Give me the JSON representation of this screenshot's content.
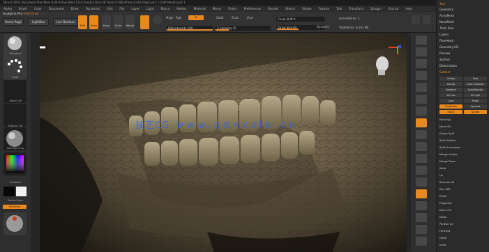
{
  "titlebar": {
    "text": "Zbrush 2021 Document   Free Mem 6.09   Active Mem 1213   Scratch Disk 48   Timer 0.008   ATime 0.001   PolyCount 1.2 KP   MeshCount 1"
  },
  "menubar": [
    "Alpha",
    "Brush",
    "Color",
    "Document",
    "Draw",
    "Dynamics",
    "Edit",
    "File",
    "Layer",
    "Light",
    "Macro",
    "Marker",
    "Material",
    "Movie",
    "Picker",
    "Preferences",
    "Render",
    "Stencil",
    "Stroke",
    "Texture",
    "Tool",
    "Transform",
    "Zplugin",
    "Zscript",
    "Help"
  ],
  "toolbar": {
    "brand_left": "Sculptris Pro",
    "brand_accent": "Grid Grad",
    "home_page": "Home Page",
    "lightbox": "LightBox",
    "live_boolean": "Live Boolean",
    "edit": "Edit",
    "draw": "Draw",
    "move": "Move",
    "scale": "Scale",
    "rotate": "Rotate",
    "mrgb": "Mrgb",
    "rgb": "Rgb",
    "m": "M",
    "zadd": "Zadd",
    "zsub": "Zsub",
    "zcut": "Zcut",
    "rgb_intensity": "Rgb Intensity 100",
    "z_intensity": "Z Intensity 25",
    "focal_shift": "Focal Shift 0",
    "draw_size": "Draw Size 64",
    "dynamic": "Dynamic",
    "active_points": "ActivePoints: 5",
    "total_points": "TotalPoints: 6.261 Mil"
  },
  "left_tray": {
    "brush": "Standard",
    "stroke": "Dots",
    "alpha": "Alpha Off",
    "texture": "Texture Off",
    "material": "MatCap Gray",
    "gradient": "Gradient",
    "switch_color": "SwitchColor",
    "alternate": "Alternate"
  },
  "viewport": {
    "watermark_cn": "技艺CG",
    "watermark_url": "www.qdnxzlb.cn"
  },
  "right_panel": {
    "header": "Tool",
    "items": [
      "Geometry",
      "ArrayMesh",
      "NanoMesh",
      "Thick Skin",
      "Layers",
      "FiberMesh",
      "Geometry HD",
      "Preview",
      "Surface",
      "Deformation"
    ],
    "subtools": "Subtool",
    "buttons": [
      "Visible",
      "Solo",
      "List All",
      "Auto Collapse",
      "Rename",
      "AutoReorder",
      "All Low",
      "All High",
      "Copy",
      "Paste",
      "Duplicate",
      "Append",
      "Insert",
      "Delete",
      "Del Other",
      "Del All",
      "Split",
      "Merge",
      "Boolean",
      "Remesh",
      "Project",
      "Extract",
      "UV Map",
      "Topology",
      "Position",
      "Size",
      "Mesh Integrity"
    ],
    "rows": [
      "Move Up",
      "Move Dn",
      "Group Split",
      "Split Hidden",
      "Split Unmasked",
      "Merge Visible",
      "Merge Down",
      "Weld",
      "Uv",
      "Remesh All",
      "Res 128",
      "Polish",
      "ProjectAll",
      "Dist 0.02",
      "Mean",
      "PA Blur 10",
      "Farthest",
      "Outer",
      "Inner"
    ],
    "labels_right": [
      "Geometry",
      "ArrayMesh",
      "NanoMesh",
      "Thick Skin",
      "Layers",
      "FiberMesh",
      "Geometry HD",
      "Preview",
      "Surface",
      "Deformation",
      "Masking",
      "Visibility",
      "Polygroups",
      "Contact",
      "Morph Target",
      "Polypaint",
      "UV Map",
      "Texture Map",
      "Displacement",
      "Normal Map",
      "Vector Displacement",
      "Display Properties",
      "Unified Skin",
      "Initialize",
      "Import",
      "Export"
    ]
  },
  "colors": {
    "accent": "#e8891f",
    "panel": "#2b2b2b",
    "watermark": "#3a69d6"
  }
}
